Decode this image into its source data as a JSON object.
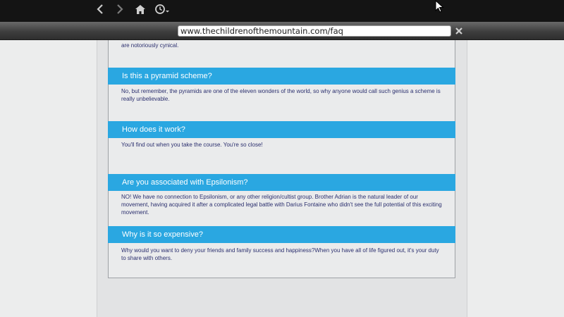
{
  "browser": {
    "url": "www.thechildrenofthemountain.com/faq",
    "icons": [
      "back-arrow-icon",
      "forward-arrow-icon",
      "home-icon",
      "history-clock-icon",
      "close-icon"
    ]
  },
  "page": {
    "truncated_top_text": "are notoriously cynical.",
    "faq": [
      {
        "question": "Is this a pyramid scheme?",
        "answer": "No, but remember, the pyramids are one of the eleven wonders of the world, so why anyone would call such genius a scheme is really unbelievable."
      },
      {
        "question": "How does it work?",
        "answer": "You'll find out when you take the course. You're so close!"
      },
      {
        "question": "Are you associated with Epsilonism?",
        "answer": "NO! We have no connection to Epsilonism, or any other religion/cultist group. Brother Adrian is the natural leader of our movement, having acquired it after a complicated legal battle with Darius Fontaine who didn't see the full potential of this exciting movement."
      },
      {
        "question": "Why is it so expensive?",
        "answer": "Why would you want to deny your friends and family success and happiness?When you have all of life figured out, it's your duty to share with others."
      }
    ]
  },
  "colors": {
    "header_blue": "#2aa7e1",
    "text_navy": "#2b2f6e"
  }
}
